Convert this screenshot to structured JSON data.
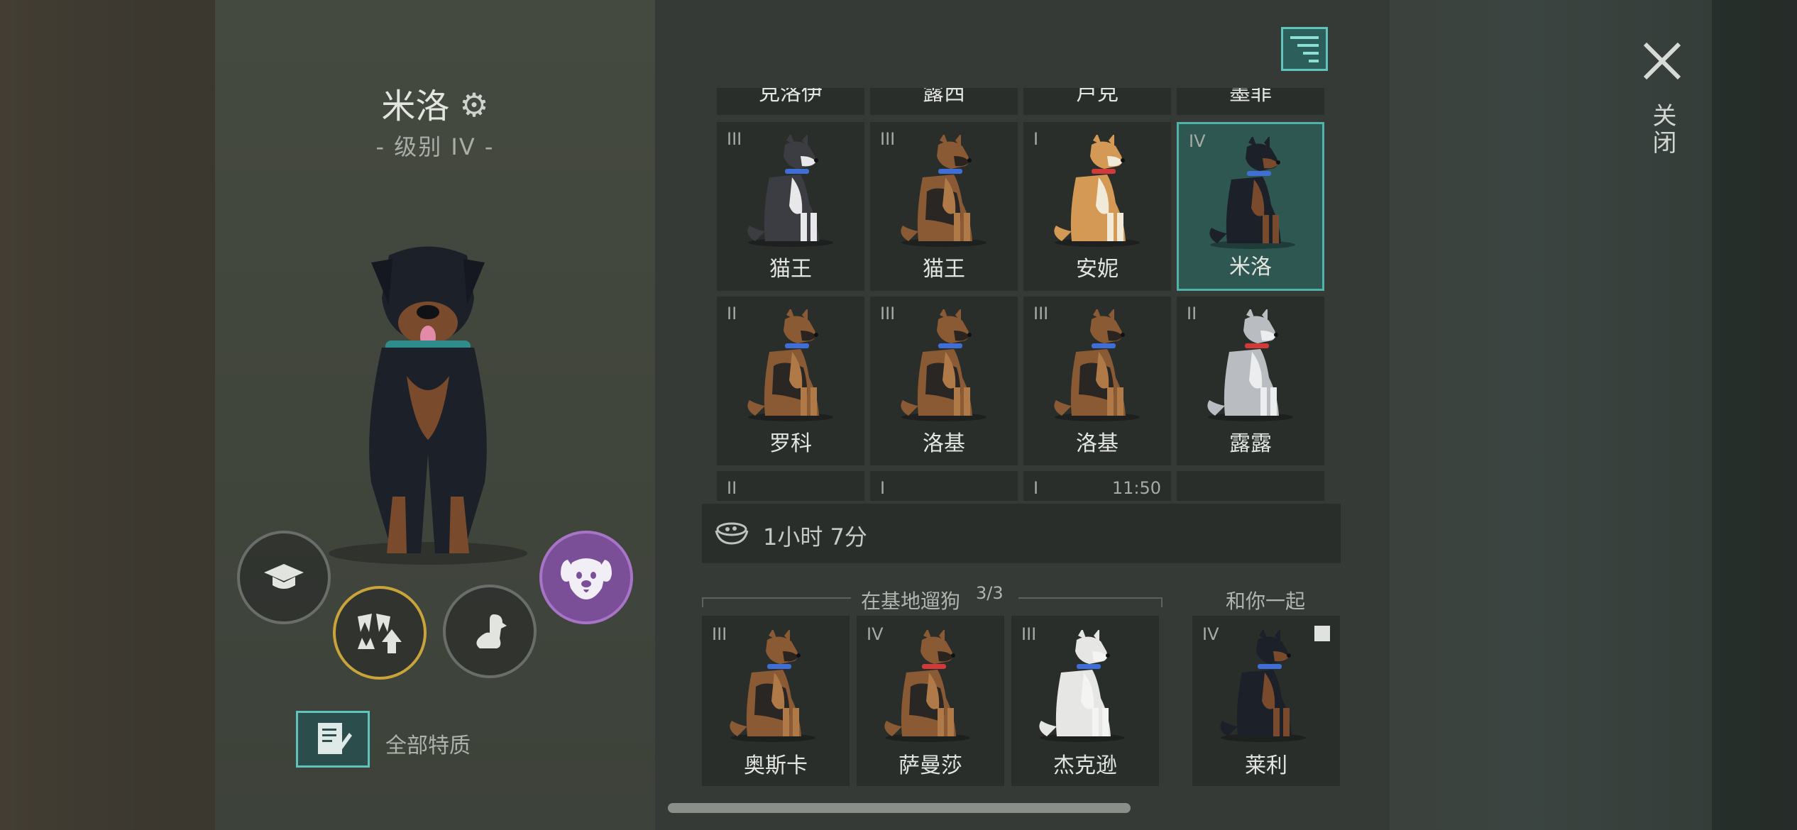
{
  "dog": {
    "name": "米洛",
    "level": "- 级别 IV -",
    "traits_label": "全部特质"
  },
  "kennel": {
    "top_row": [
      "克洛伊",
      "露西",
      "卢克",
      "墨菲"
    ],
    "cells": [
      {
        "level": "III",
        "name": "猫王",
        "coat": "husky",
        "collar": "#3f6fd6"
      },
      {
        "level": "III",
        "name": "猫王",
        "coat": "shepherd",
        "collar": "#3f6fd6"
      },
      {
        "level": "I",
        "name": "安妮",
        "coat": "corgi",
        "collar": "#d23a3a"
      },
      {
        "level": "IV",
        "name": "米洛",
        "coat": "rottweiler",
        "collar": "#3f6fd6",
        "selected": true
      },
      {
        "level": "II",
        "name": "罗科",
        "coat": "shepherd",
        "collar": "#3f6fd6"
      },
      {
        "level": "III",
        "name": "洛基",
        "coat": "shepherd",
        "collar": "#3f6fd6"
      },
      {
        "level": "III",
        "name": "洛基",
        "coat": "shepherd",
        "collar": "#3f6fd6"
      },
      {
        "level": "II",
        "name": "露露",
        "coat": "husky-grey",
        "collar": "#d23a3a"
      }
    ],
    "partial_row": [
      {
        "level": "II"
      },
      {
        "level": "I"
      },
      {
        "level": "I",
        "timer": "11:50"
      },
      {
        "level": ""
      }
    ],
    "food_time": "1小时 7分"
  },
  "walk": {
    "title": "在基地遛狗",
    "count": "3/3",
    "dogs": [
      {
        "level": "III",
        "name": "奥斯卡",
        "coat": "shepherd",
        "collar": "#3f6fd6"
      },
      {
        "level": "IV",
        "name": "萨曼莎",
        "coat": "shepherd",
        "collar": "#d23a3a"
      },
      {
        "level": "III",
        "name": "杰克逊",
        "coat": "white",
        "collar": "#3f6fd6"
      }
    ]
  },
  "with_you": {
    "title": "和你一起",
    "dog": {
      "level": "IV",
      "name": "莱利",
      "coat": "rottweiler",
      "collar": "#3f6fd6"
    }
  },
  "close_label": "关闭",
  "colors": {
    "accent_teal": "#5fc4bb",
    "upgrade_gold": "#c9a43a",
    "active_purple": "#7b4f98"
  },
  "icons": [
    "gear-icon",
    "graduation-cap-icon",
    "fang-upgrade-icon",
    "sitting-dog-icon",
    "dog-face-icon",
    "notebook-pen-icon",
    "menu-icon",
    "food-bowl-icon",
    "close-icon",
    "box-icon"
  ]
}
